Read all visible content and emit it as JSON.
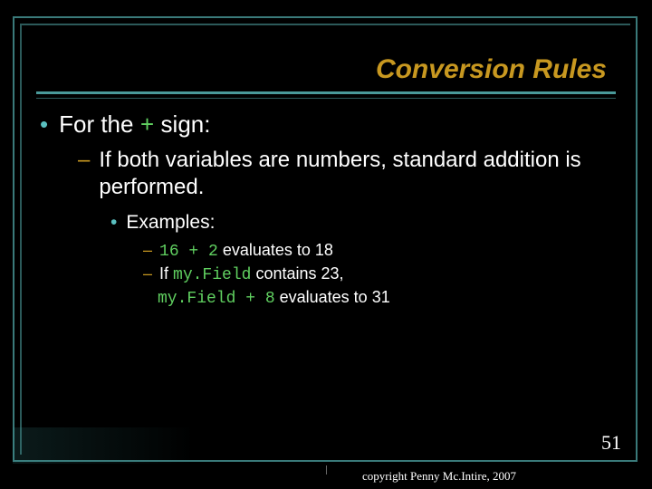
{
  "title": "Conversion Rules",
  "bullet1_prefix": "For the ",
  "bullet1_plus": "+",
  "bullet1_suffix": " sign:",
  "dash1_text": "If both variables are numbers, standard addition is performed.",
  "examples_label": "Examples:",
  "ex1_code": "16 + 2",
  "ex1_after": "  evaluates to 18",
  "ex2_prefix": "If ",
  "ex2_field": "my.Field",
  "ex2_suffix": " contains 23,",
  "ex3_code": "my.Field + 8",
  "ex3_after": "  evaluates to 31",
  "slide_number": "51",
  "copyright": "copyright Penny Mc.Intire, 2007"
}
